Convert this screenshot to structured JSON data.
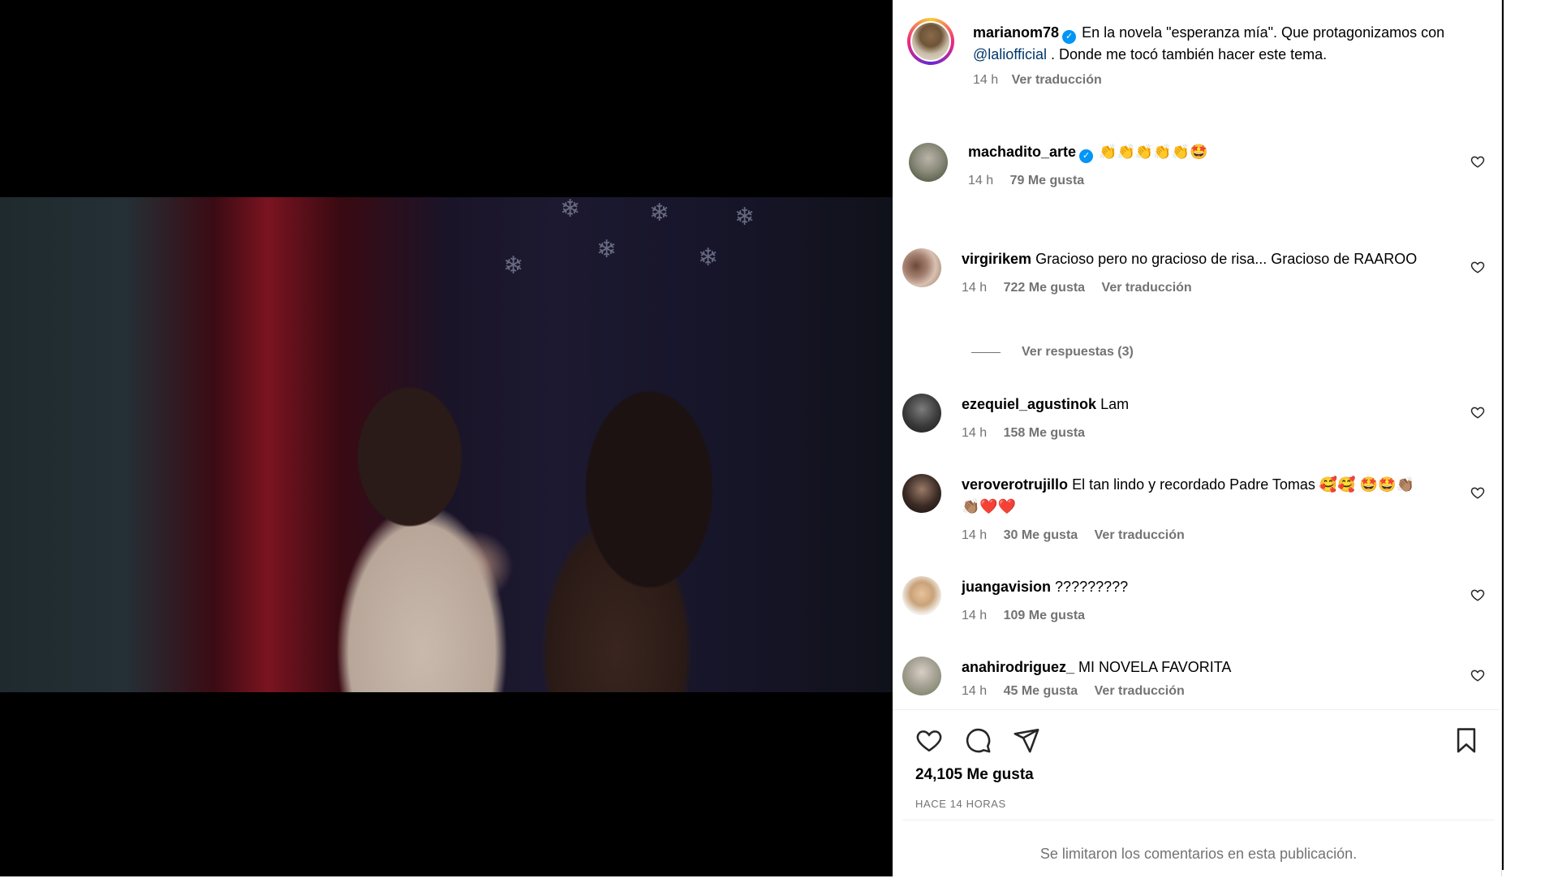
{
  "video": {
    "volume_icon": "volume-icon"
  },
  "caption": {
    "username": "marianom78",
    "verified_icon": "verified-badge-icon",
    "text_before_mention": "En la novela \"esperanza mía\". Que protagonizamos con ",
    "mention": "@laliofficial",
    "text_after_mention": " . Donde me tocó también hacer este tema.",
    "time": "14 h",
    "translate_label": "Ver traducción"
  },
  "comments": [
    {
      "username": "machadito_arte",
      "verified": true,
      "text": "👏👏👏👏👏🤩",
      "time": "14 h",
      "likes": "79 Me gusta",
      "translate": ""
    },
    {
      "username": "virgirikem",
      "verified": false,
      "text": "Gracioso pero no gracioso de risa... Gracioso de RAAROO",
      "time": "14 h",
      "likes": "722 Me gusta",
      "translate": "Ver traducción"
    },
    {
      "username": "ezequiel_agustinok",
      "verified": false,
      "text": "Lam",
      "time": "14 h",
      "likes": "158 Me gusta",
      "translate": ""
    },
    {
      "username": "veroverotrujillo",
      "verified": false,
      "text": "El tan lindo y recordado Padre Tomas 🥰🥰 🤩🤩👏🏽👏🏽❤️❤️",
      "time": "14 h",
      "likes": "30 Me gusta",
      "translate": "Ver traducción"
    },
    {
      "username": "juangavision",
      "verified": false,
      "text": "?????????",
      "time": "14 h",
      "likes": "109 Me gusta",
      "translate": ""
    },
    {
      "username": "anahirodriguez_",
      "verified": false,
      "text": "MI NOVELA FAVORITA",
      "time": "14 h",
      "likes": "45 Me gusta",
      "translate": "Ver traducción"
    }
  ],
  "replies_label": "Ver respuestas (3)",
  "actions": {
    "like_icon": "heart-icon",
    "comment_icon": "comment-icon",
    "share_icon": "share-icon",
    "save_icon": "bookmark-icon"
  },
  "likes_total": "24,105 Me gusta",
  "posted_ago": "HACE 14 HORAS",
  "comments_limited": "Se limitaron los comentarios en esta publicación.",
  "colors": {
    "link": "#00376b",
    "verified": "#0095f6",
    "secondary_text": "#737373"
  }
}
